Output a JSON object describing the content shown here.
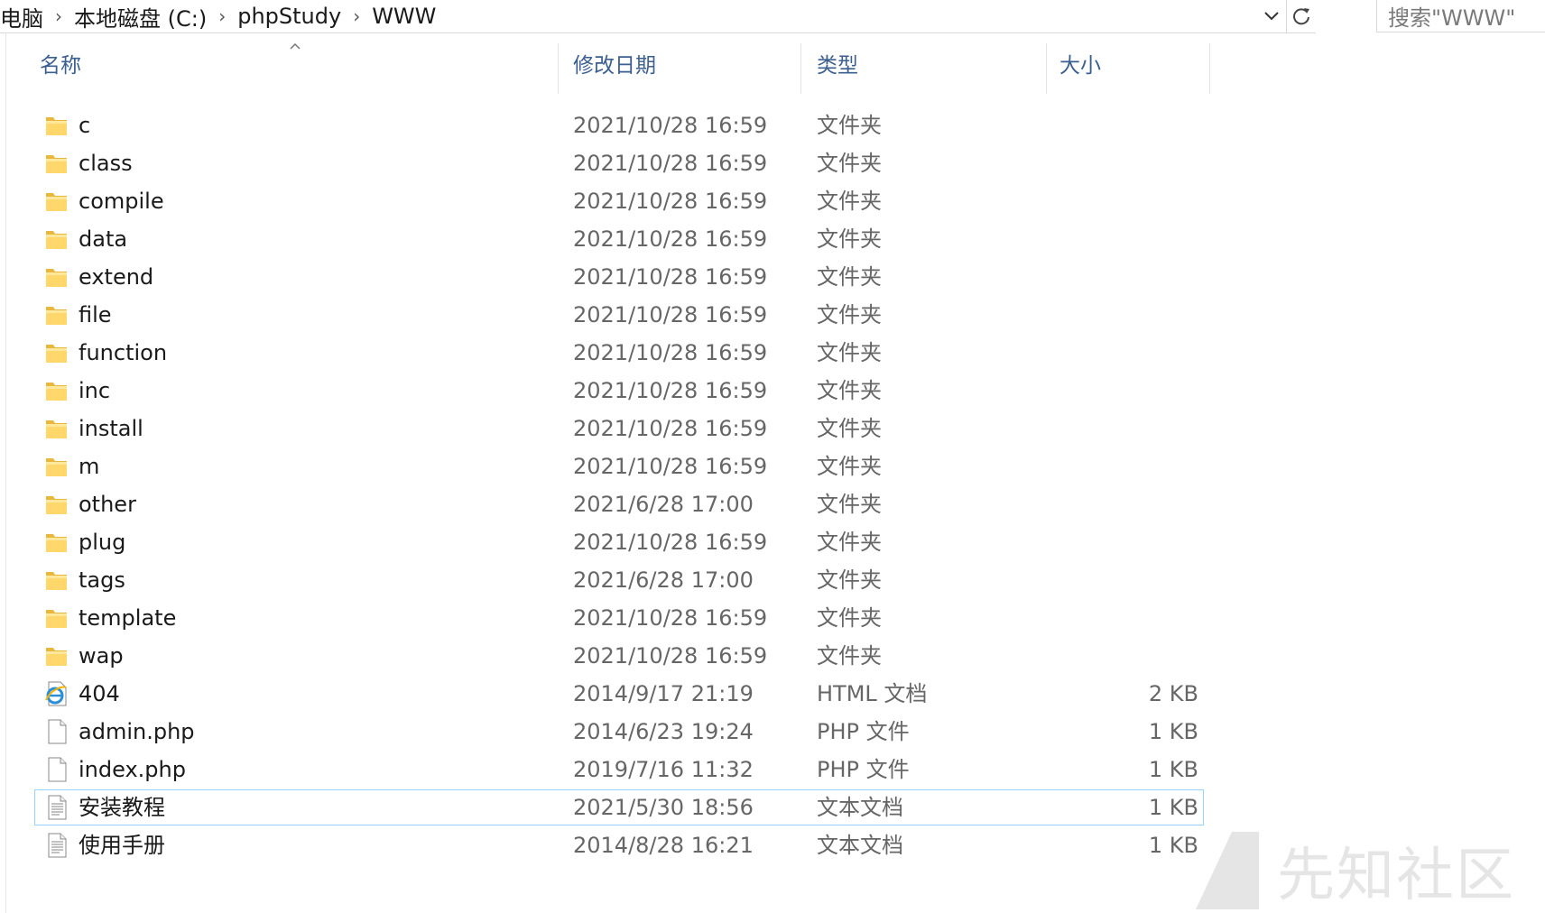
{
  "address_bar": {
    "breadcrumbs": [
      "电脑",
      "本地磁盘 (C:)",
      "phpStudy",
      "WWW"
    ],
    "search_placeholder": "搜索\"WWW\""
  },
  "columns": {
    "name": "名称",
    "date": "修改日期",
    "type": "类型",
    "size": "大小"
  },
  "files": [
    {
      "name": "c",
      "date": "2021/10/28 16:59",
      "type": "文件夹",
      "size": "",
      "icon": "folder-icon"
    },
    {
      "name": "class",
      "date": "2021/10/28 16:59",
      "type": "文件夹",
      "size": "",
      "icon": "folder-icon"
    },
    {
      "name": "compile",
      "date": "2021/10/28 16:59",
      "type": "文件夹",
      "size": "",
      "icon": "folder-icon"
    },
    {
      "name": "data",
      "date": "2021/10/28 16:59",
      "type": "文件夹",
      "size": "",
      "icon": "folder-icon"
    },
    {
      "name": "extend",
      "date": "2021/10/28 16:59",
      "type": "文件夹",
      "size": "",
      "icon": "folder-icon"
    },
    {
      "name": "file",
      "date": "2021/10/28 16:59",
      "type": "文件夹",
      "size": "",
      "icon": "folder-icon"
    },
    {
      "name": "function",
      "date": "2021/10/28 16:59",
      "type": "文件夹",
      "size": "",
      "icon": "folder-icon"
    },
    {
      "name": "inc",
      "date": "2021/10/28 16:59",
      "type": "文件夹",
      "size": "",
      "icon": "folder-icon"
    },
    {
      "name": "install",
      "date": "2021/10/28 16:59",
      "type": "文件夹",
      "size": "",
      "icon": "folder-icon"
    },
    {
      "name": "m",
      "date": "2021/10/28 16:59",
      "type": "文件夹",
      "size": "",
      "icon": "folder-icon"
    },
    {
      "name": "other",
      "date": "2021/6/28 17:00",
      "type": "文件夹",
      "size": "",
      "icon": "folder-icon"
    },
    {
      "name": "plug",
      "date": "2021/10/28 16:59",
      "type": "文件夹",
      "size": "",
      "icon": "folder-icon"
    },
    {
      "name": "tags",
      "date": "2021/6/28 17:00",
      "type": "文件夹",
      "size": "",
      "icon": "folder-icon"
    },
    {
      "name": "template",
      "date": "2021/10/28 16:59",
      "type": "文件夹",
      "size": "",
      "icon": "folder-icon"
    },
    {
      "name": "wap",
      "date": "2021/10/28 16:59",
      "type": "文件夹",
      "size": "",
      "icon": "folder-icon"
    },
    {
      "name": "404",
      "date": "2014/9/17 21:19",
      "type": "HTML 文档",
      "size": "2 KB",
      "icon": "ie-html-icon"
    },
    {
      "name": "admin.php",
      "date": "2014/6/23 19:24",
      "type": "PHP 文件",
      "size": "1 KB",
      "icon": "blank-file-icon"
    },
    {
      "name": "index.php",
      "date": "2019/7/16 11:32",
      "type": "PHP 文件",
      "size": "1 KB",
      "icon": "blank-file-icon"
    },
    {
      "name": "安装教程",
      "date": "2021/5/30 18:56",
      "type": "文本文档",
      "size": "1 KB",
      "icon": "text-file-icon",
      "selected": true
    },
    {
      "name": "使用手册",
      "date": "2014/8/28 16:21",
      "type": "文本文档",
      "size": "1 KB",
      "icon": "text-file-icon"
    }
  ],
  "watermark": {
    "text": "先知社区"
  }
}
